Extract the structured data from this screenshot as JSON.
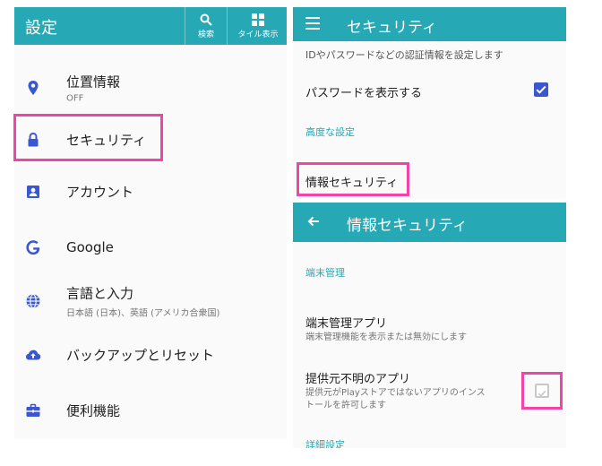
{
  "settings_panel": {
    "title": "設定",
    "actions": [
      {
        "label": "検索"
      },
      {
        "label": "タイル表示"
      }
    ],
    "items": [
      {
        "title": "位置情報",
        "subtitle": "OFF"
      },
      {
        "title": "セキュリティ"
      },
      {
        "title": "アカウント"
      },
      {
        "title": "Google"
      },
      {
        "title": "言語と入力",
        "subtitle": "日本語 (日本)、英語 (アメリカ合衆国)"
      },
      {
        "title": "バックアップとリセット"
      },
      {
        "title": "便利機能"
      }
    ]
  },
  "security_panel": {
    "title": "セキュリティ",
    "cut_text": "IDやパスワードなどの認証情報を設定します",
    "show_password": {
      "label": "パスワードを表示する",
      "checked": true
    },
    "advanced_header": "高度な設定",
    "info_security_item": "情報セキュリティ"
  },
  "info_security_panel": {
    "title": "情報セキュリティ",
    "section_device_admin": "端末管理",
    "device_admin_apps": {
      "title": "端末管理アプリ",
      "subtitle": "端末管理機能を表示または無効にします"
    },
    "unknown_sources": {
      "title": "提供元不明のアプリ",
      "subtitle_line1": "提供元がPlayストアではないアプリのインス",
      "subtitle_line2": "トールを許可します",
      "checked": false
    },
    "section_details": "詳細設定"
  },
  "colors": {
    "accent": "#26a9b5",
    "highlight": "#ef44a8",
    "checkbox": "#3b57d0",
    "icon": "#3b57d0"
  }
}
